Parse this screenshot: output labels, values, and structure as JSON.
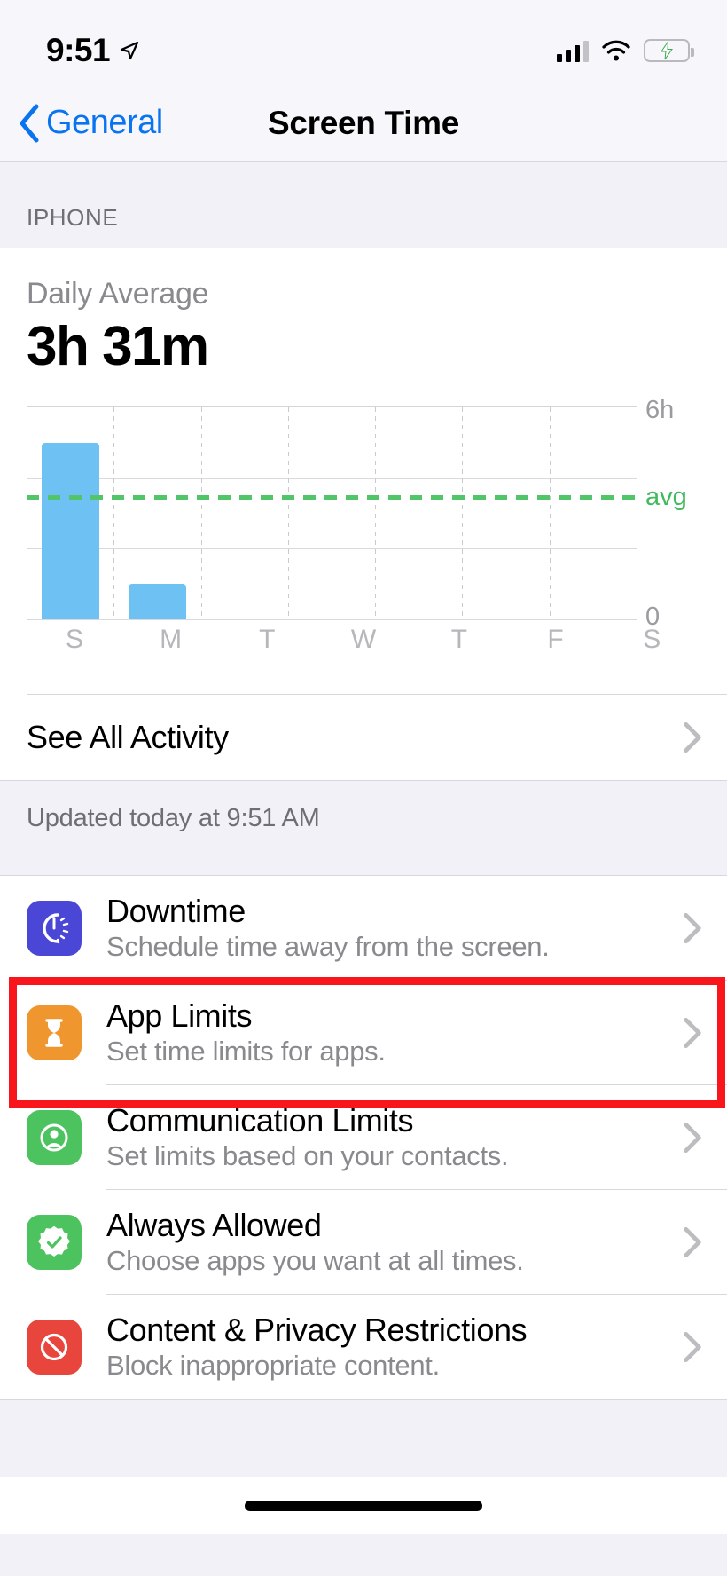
{
  "status_bar": {
    "time": "9:51",
    "location_icon": "location-arrow-icon",
    "cellular_icon": "cellular-bars-icon",
    "wifi_icon": "wifi-icon",
    "battery_icon": "battery-charging-icon"
  },
  "nav": {
    "back_label": "General",
    "back_icon": "chevron-left-icon",
    "title": "Screen Time"
  },
  "section": {
    "header": "IPHONE"
  },
  "summary": {
    "label": "Daily Average",
    "value": "3h 31m"
  },
  "chart_data": {
    "type": "bar",
    "title": "Daily Average",
    "categories": [
      "S",
      "M",
      "T",
      "W",
      "T",
      "F",
      "S"
    ],
    "values": [
      5.0,
      1.0,
      0,
      0,
      0,
      0,
      0
    ],
    "ylabel": "",
    "xlabel": "",
    "ylim": [
      0,
      6
    ],
    "y_tick_labels": [
      "6h",
      "0"
    ],
    "grid": true,
    "average_line": {
      "label": "avg",
      "value": 3.52,
      "style": "dashed",
      "color": "#3fba5c"
    },
    "bar_color": "#6ec1f3",
    "legend_position": "right"
  },
  "see_all": {
    "label": "See All Activity",
    "chevron_icon": "chevron-right-icon"
  },
  "updated_note": "Updated today at 9:51 AM",
  "features": [
    {
      "title": "Downtime",
      "subtitle": "Schedule time away from the screen.",
      "icon_name": "downtime-icon",
      "icon_color": "#4a46d6",
      "chevron_icon": "chevron-right-icon",
      "highlighted": false
    },
    {
      "title": "App Limits",
      "subtitle": "Set time limits for apps.",
      "icon_name": "hourglass-icon",
      "icon_color": "#f0962e",
      "chevron_icon": "chevron-right-icon",
      "highlighted": true
    },
    {
      "title": "Communication Limits",
      "subtitle": "Set limits based on your contacts.",
      "icon_name": "person-circle-icon",
      "icon_color": "#4cc35e",
      "chevron_icon": "chevron-right-icon",
      "highlighted": false
    },
    {
      "title": "Always Allowed",
      "subtitle": "Choose apps you want at all times.",
      "icon_name": "checkmark-seal-icon",
      "icon_color": "#4cc35e",
      "chevron_icon": "chevron-right-icon",
      "highlighted": false
    },
    {
      "title": "Content & Privacy Restrictions",
      "subtitle": "Block inappropriate content.",
      "icon_name": "prohibition-icon",
      "icon_color": "#e8453c",
      "chevron_icon": "chevron-right-icon",
      "highlighted": false
    }
  ],
  "highlight_color": "#f8151b",
  "home_indicator": "home-indicator"
}
